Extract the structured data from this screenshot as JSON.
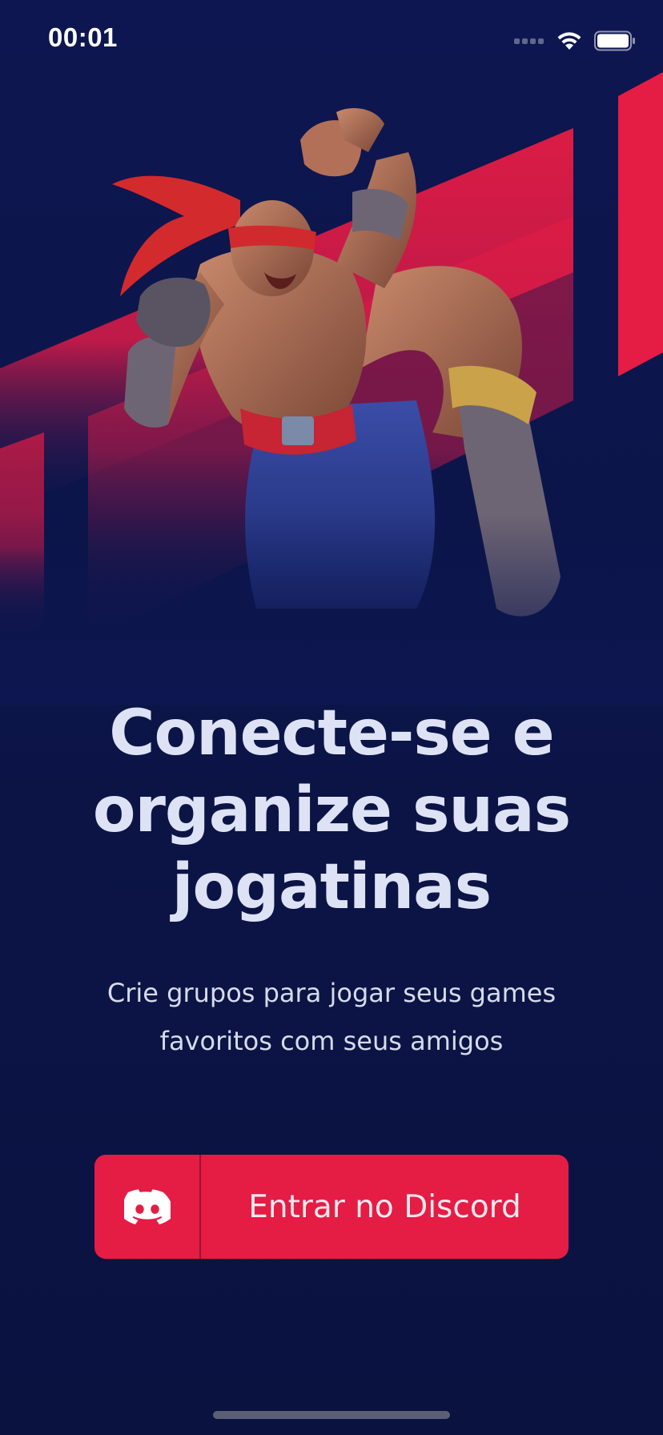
{
  "status_bar": {
    "time": "00:01",
    "icons": [
      "cellular-signal-icon",
      "wifi-icon",
      "battery-icon"
    ]
  },
  "hero": {
    "illustration": "fighter-character-illustration",
    "colors": {
      "background": "#0d1650",
      "stripe": "#e51c44"
    }
  },
  "headline": "Conecte-se e organize suas jogatinas",
  "subtitle": "Crie grupos para jogar seus games favoritos com seus amigos",
  "discord_button": {
    "icon": "discord-icon",
    "label": "Entrar no Discord",
    "color": "#e51c44"
  }
}
